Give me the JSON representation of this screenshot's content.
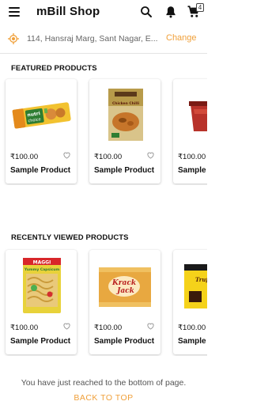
{
  "appbar": {
    "title": "mBill Shop",
    "menu_icon": "hamburger-menu-icon",
    "search_icon": "search-icon",
    "bell_icon": "notification-bell-icon",
    "cart_icon": "cart-icon",
    "cart_count": "4"
  },
  "address": {
    "text": "114, Hansraj Marg, Sant Nagar, E...",
    "change_label": "Change",
    "icon": "location-target-icon"
  },
  "featured": {
    "title": "FEATURED PRODUCTS",
    "products": [
      {
        "price": "₹100.00",
        "name": "Sample Product",
        "image": "nutri-choice-biscuit-pack"
      },
      {
        "price": "₹100.00",
        "name": "Sample Product",
        "image": "chicken-chilli-ready-meal"
      },
      {
        "price": "₹100.00",
        "name": "Sample",
        "image": "red-cup-product"
      }
    ]
  },
  "recent": {
    "title": "RECENTLY VIEWED PRODUCTS",
    "products": [
      {
        "price": "₹100.00",
        "name": "Sample Product",
        "image": "maggi-yummy-capsicum-pack"
      },
      {
        "price": "₹100.00",
        "name": "Sample Product",
        "image": "krack-jack-biscuit-pack"
      },
      {
        "price": "₹100.00",
        "name": "Sample",
        "image": "truffle-cake-box"
      }
    ]
  },
  "footer": {
    "message": "You have just reached to the bottom of page.",
    "back_to_top": "BACK TO TOP"
  },
  "colors": {
    "accent": "#f0a03a",
    "text": "#111111",
    "muted": "#666666"
  }
}
